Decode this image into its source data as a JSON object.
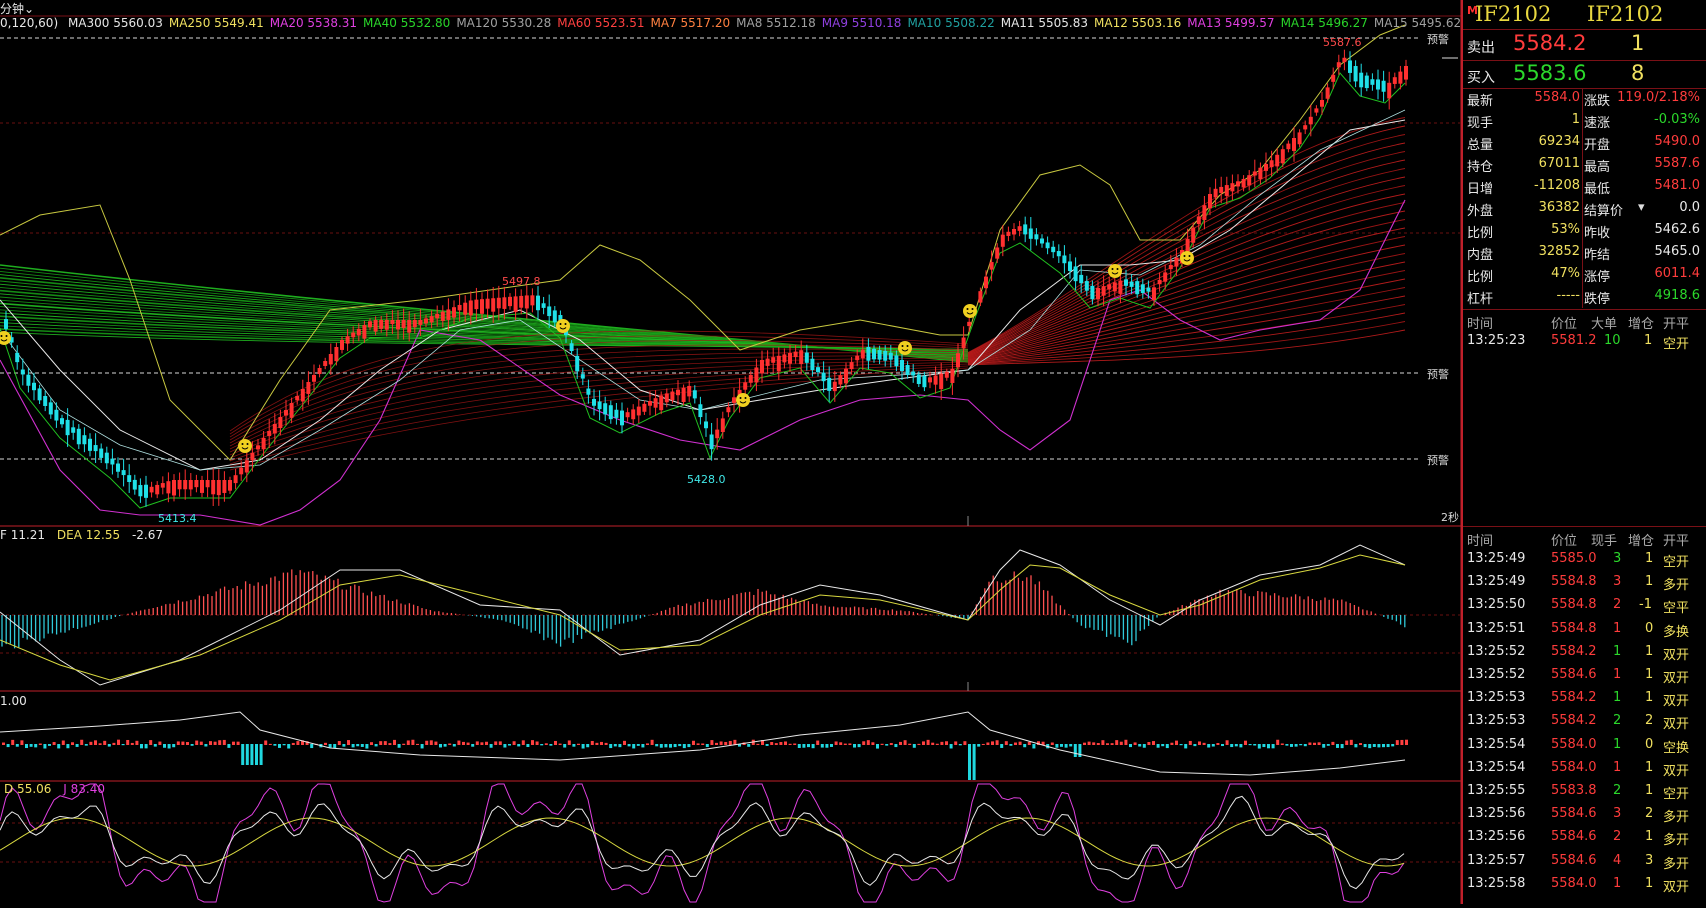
{
  "chart_header": {
    "period_label": "分钟",
    "params": "0,120,60)",
    "ma_items": [
      {
        "label": "MA300 5560.03",
        "color": "#e6e6e6"
      },
      {
        "label": "MA250 5549.41",
        "color": "#f0e060"
      },
      {
        "label": "MA20 5538.31",
        "color": "#e040e0"
      },
      {
        "label": "MA40 5532.80",
        "color": "#2ad42a"
      },
      {
        "label": "MA120 5530.28",
        "color": "#a0a0a0"
      },
      {
        "label": "MA60 5523.51",
        "color": "#ff4040"
      },
      {
        "label": "MA7 5517.20",
        "color": "#ff8040"
      },
      {
        "label": "MA8 5512.18",
        "color": "#a0a0a0"
      },
      {
        "label": "MA9 5510.18",
        "color": "#9040e0"
      },
      {
        "label": "MA10 5508.22",
        "color": "#20a0a0"
      },
      {
        "label": "MA11 5505.83",
        "color": "#e6e6e6"
      },
      {
        "label": "MA12 5503.16",
        "color": "#f0e060"
      },
      {
        "label": "MA13 5499.57",
        "color": "#e040e0"
      },
      {
        "label": "MA14 5496.27",
        "color": "#2ad42a"
      },
      {
        "label": "MA15 5495.62",
        "color": "#a0a0a0"
      }
    ]
  },
  "price_labels": {
    "high": "5587.6",
    "mid_high": "5497.8",
    "low1": "5413.4",
    "low2": "5428.0",
    "alert": "预警",
    "timer": "2秒"
  },
  "macd_header": {
    "dif": "F 11.21",
    "dea": "DEA 12.55",
    "macd": "-2.67"
  },
  "vol_header": {
    "val": "1.00"
  },
  "kdj_header": {
    "d": "D 55.06",
    "j": "J 83.40"
  },
  "panel": {
    "marker": "M",
    "code1": "IF2102",
    "code2": "IF2102",
    "sell": {
      "label": "卖出",
      "price": "5584.2",
      "qty": "1"
    },
    "buy": {
      "label": "买入",
      "price": "5583.6",
      "qty": "8"
    },
    "stats": [
      {
        "k": "最新",
        "v": "5584.0",
        "vc": "red",
        "k2": "涨跌",
        "v2": "119.0/2.18%",
        "v2c": "red"
      },
      {
        "k": "现手",
        "v": "1",
        "vc": "yellow",
        "k2": "速涨",
        "v2": "-0.03%",
        "v2c": "green"
      },
      {
        "k": "总量",
        "v": "69234",
        "vc": "yellow",
        "k2": "开盘",
        "v2": "5490.0",
        "v2c": "red"
      },
      {
        "k": "持仓",
        "v": "67011",
        "vc": "yellow",
        "k2": "最高",
        "v2": "5587.6",
        "v2c": "red"
      },
      {
        "k": "日增",
        "v": "-11208",
        "vc": "yellow",
        "k2": "最低",
        "v2": "5481.0",
        "v2c": "red"
      },
      {
        "k": "外盘",
        "v": "36382",
        "vc": "yellow",
        "k2": "结算价",
        "v2": "0.0",
        "v2c": "white"
      },
      {
        "k": "比例",
        "v": "53%",
        "vc": "yellow",
        "k2": "昨收",
        "v2": "5462.6",
        "v2c": "white"
      },
      {
        "k": "内盘",
        "v": "32852",
        "vc": "yellow",
        "k2": "昨结",
        "v2": "5465.0",
        "v2c": "white"
      },
      {
        "k": "比例",
        "v": "47%",
        "vc": "yellow",
        "k2": "涨停",
        "v2": "6011.4",
        "v2c": "red"
      },
      {
        "k": "杠杆",
        "v": "-----",
        "vc": "yellow",
        "k2": "跌停",
        "v2": "4918.6",
        "v2c": "green"
      }
    ],
    "big_header": {
      "time": "时间",
      "price": "价位",
      "big": "大单",
      "inc": "增仓",
      "open": "开平"
    },
    "big_row": {
      "time": "13:25:23",
      "price": "5581.2",
      "big": "10",
      "inc": "1",
      "open": "空开"
    },
    "tick_header": {
      "time": "时间",
      "price": "价位",
      "hand": "现手",
      "inc": "增仓",
      "open": "开平"
    },
    "ticks": [
      {
        "time": "13:25:49",
        "price": "5585.0",
        "hand": "3",
        "hc": "green",
        "inc": "1",
        "open": "空开"
      },
      {
        "time": "13:25:49",
        "price": "5584.8",
        "hand": "3",
        "hc": "red",
        "inc": "1",
        "open": "多开"
      },
      {
        "time": "13:25:50",
        "price": "5584.8",
        "hand": "2",
        "hc": "red",
        "inc": "-1",
        "open": "空平"
      },
      {
        "time": "13:25:51",
        "price": "5584.8",
        "hand": "1",
        "hc": "red",
        "inc": "0",
        "open": "多换"
      },
      {
        "time": "13:25:52",
        "price": "5584.2",
        "hand": "1",
        "hc": "green",
        "inc": "1",
        "open": "双开"
      },
      {
        "time": "13:25:52",
        "price": "5584.6",
        "hand": "1",
        "hc": "red",
        "inc": "1",
        "open": "双开"
      },
      {
        "time": "13:25:53",
        "price": "5584.2",
        "hand": "1",
        "hc": "green",
        "inc": "1",
        "open": "双开"
      },
      {
        "time": "13:25:53",
        "price": "5584.2",
        "hand": "2",
        "hc": "green",
        "inc": "2",
        "open": "双开"
      },
      {
        "time": "13:25:54",
        "price": "5584.0",
        "hand": "1",
        "hc": "green",
        "inc": "0",
        "open": "空换"
      },
      {
        "time": "13:25:54",
        "price": "5584.0",
        "hand": "1",
        "hc": "red",
        "inc": "1",
        "open": "双开"
      },
      {
        "time": "13:25:55",
        "price": "5583.8",
        "hand": "2",
        "hc": "green",
        "inc": "1",
        "open": "空开"
      },
      {
        "time": "13:25:56",
        "price": "5584.6",
        "hand": "3",
        "hc": "red",
        "inc": "2",
        "open": "多开"
      },
      {
        "time": "13:25:56",
        "price": "5584.6",
        "hand": "2",
        "hc": "red",
        "inc": "1",
        "open": "多开"
      },
      {
        "time": "13:25:57",
        "price": "5584.6",
        "hand": "4",
        "hc": "red",
        "inc": "3",
        "open": "多开"
      },
      {
        "time": "13:25:58",
        "price": "5584.0",
        "hand": "1",
        "hc": "red",
        "inc": "1",
        "open": "双开"
      }
    ]
  }
}
